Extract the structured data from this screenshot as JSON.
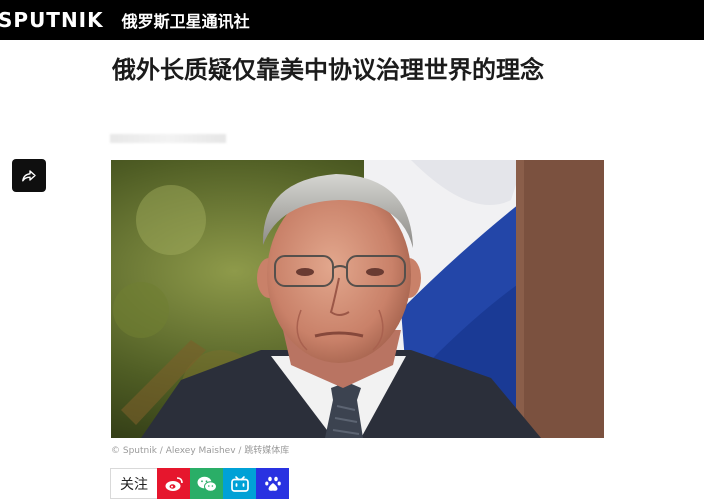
{
  "header": {
    "logo_text": "SPUTNIK",
    "site_name": "俄罗斯卫星通讯社",
    "background": "#000000"
  },
  "article": {
    "title": "俄外长质疑仅靠美中协议治理世界的理念",
    "photo_caption": "© Sputnik / Alexey Maishev / 跳转媒体库"
  },
  "share": {
    "icon": "share-icon"
  },
  "social_bar": {
    "follow_label": "关注",
    "buttons": [
      {
        "icon": "weibo-icon",
        "color": "#e6162d"
      },
      {
        "icon": "wechat-icon",
        "color": "#2aae67"
      },
      {
        "icon": "bilibili-icon",
        "color": "#00a1d6"
      },
      {
        "icon": "baidu-icon",
        "color": "#2932e1"
      }
    ]
  }
}
